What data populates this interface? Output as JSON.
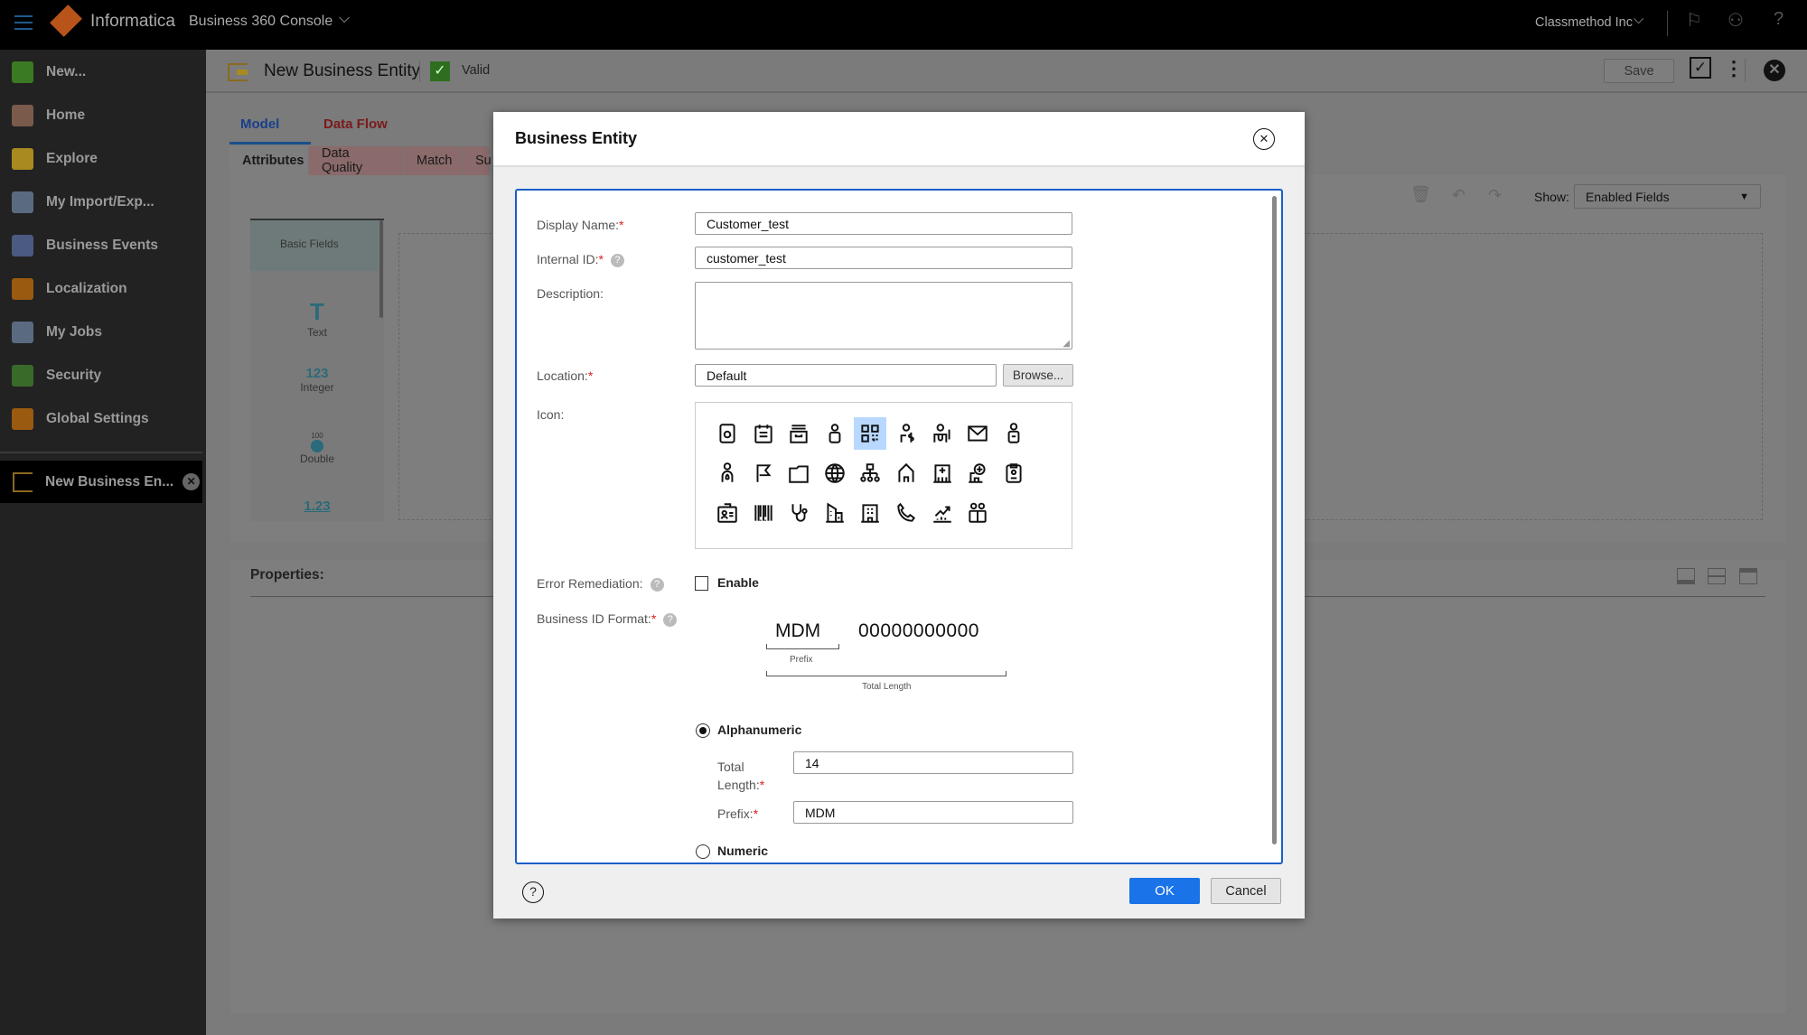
{
  "topbar": {
    "brand": "Informatica",
    "product": "Business 360 Console",
    "org": "Classmethod Inc"
  },
  "sidebar": {
    "items": [
      {
        "label": "New...",
        "icon": "plus-icon",
        "color": "#3a7a22"
      },
      {
        "label": "Home",
        "icon": "home-icon",
        "color": "#7a5a4a"
      },
      {
        "label": "Explore",
        "icon": "folder-icon",
        "color": "#a88a20"
      },
      {
        "label": "My Import/Exp...",
        "icon": "document-icon",
        "color": "#5a6a80"
      },
      {
        "label": "Business Events",
        "icon": "calendar-grid-icon",
        "color": "#4a5a80"
      },
      {
        "label": "Localization",
        "icon": "globe-icon",
        "color": "#9a5a10"
      },
      {
        "label": "My Jobs",
        "icon": "jobs-icon",
        "color": "#5a6a80"
      },
      {
        "label": "Security",
        "icon": "shield-icon",
        "color": "#3a6a2a"
      },
      {
        "label": "Global Settings",
        "icon": "gear-icon",
        "color": "#9a5a10"
      }
    ],
    "open_tab": "New Business En..."
  },
  "header": {
    "title": "New Business Entity",
    "status": "Valid",
    "save": "Save"
  },
  "tabs": {
    "primary": [
      "Model",
      "Data Flow"
    ],
    "secondary": [
      "Attributes",
      "Data Quality",
      "Match",
      "Su"
    ]
  },
  "palette": {
    "title": "Basic Fields",
    "items": [
      {
        "glyph": "T",
        "label": "Text"
      },
      {
        "glyph": "123",
        "label": "Integer"
      },
      {
        "glyph": "100",
        "label": "Double"
      },
      {
        "glyph": "1.23",
        "label": ""
      }
    ]
  },
  "toolbar": {
    "show_label": "Show:",
    "show_value": "Enabled Fields"
  },
  "properties": {
    "title": "Properties:"
  },
  "modal": {
    "title": "Business Entity",
    "display_name_label": "Display Name:",
    "display_name": "Customer_test",
    "internal_id_label": "Internal ID:",
    "internal_id": "customer_test",
    "description_label": "Description:",
    "description": "",
    "location_label": "Location:",
    "location": "Default",
    "browse": "Browse...",
    "icon_label": "Icon:",
    "icons": [
      "contact-card",
      "calendar",
      "inbox",
      "person",
      "qr-code",
      "person-dollar",
      "doctor",
      "envelope",
      "person-badge",
      "person-drop",
      "flag",
      "folder",
      "globe",
      "hierarchy",
      "house",
      "hospital",
      "clinic",
      "clipboard-person",
      "id-card",
      "barcode",
      "stethoscope",
      "buildings",
      "office",
      "phone",
      "chart-up",
      "group"
    ],
    "selected_icon": "qr-code",
    "error_remediation_label": "Error Remediation:",
    "enable_label": "Enable",
    "enable_checked": false,
    "business_id_label": "Business ID Format:",
    "preview_prefix": "MDM",
    "preview_digits": "00000000000",
    "prefix_caption": "Prefix",
    "total_caption": "Total Length",
    "alphanumeric_label": "Alphanumeric",
    "alphanumeric_selected": true,
    "total_length_label_1": "Total",
    "total_length_label_2": "Length:",
    "total_length": "14",
    "prefix_label": "Prefix:",
    "prefix": "MDM",
    "numeric_label": "Numeric",
    "ok": "OK",
    "cancel": "Cancel"
  },
  "colors": {
    "accent": "#1a73e8",
    "valid": "#2f6e1e"
  }
}
